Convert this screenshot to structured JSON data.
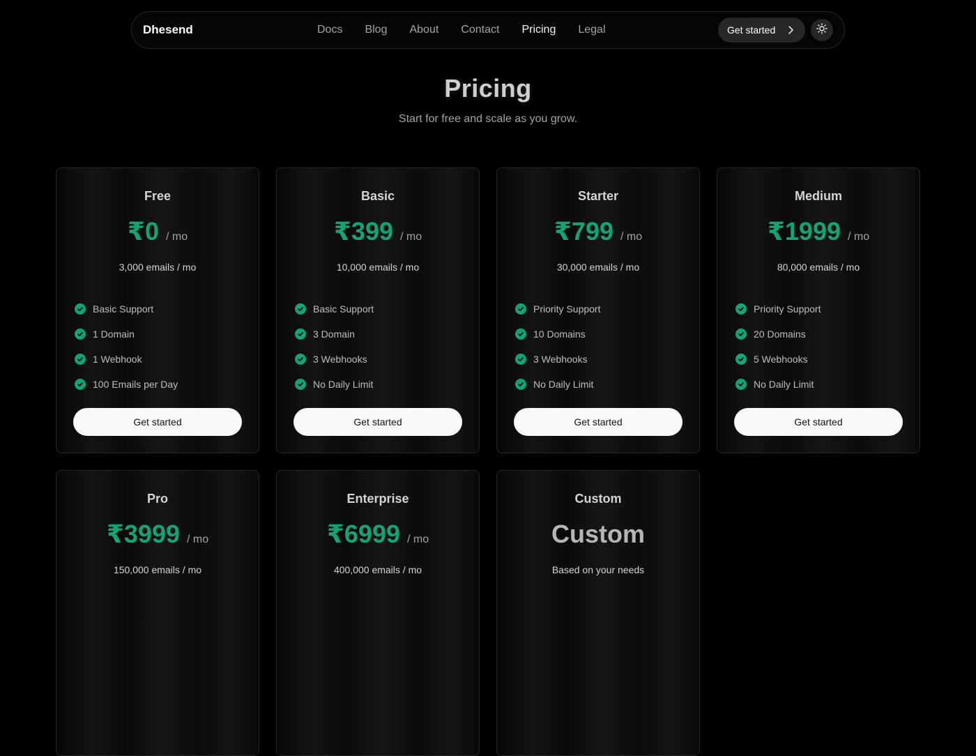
{
  "nav": {
    "brand": "Dhesend",
    "links": [
      "Docs",
      "Blog",
      "About",
      "Contact",
      "Pricing",
      "Legal"
    ],
    "active": "Pricing",
    "cta": "Get started"
  },
  "hero": {
    "title": "Pricing",
    "subtitle": "Start for free and scale as you grow."
  },
  "plans": [
    {
      "name": "Free",
      "price": "₹0",
      "period": "/ mo",
      "quota": "3,000 emails / mo",
      "features": [
        "Basic Support",
        "1 Domain",
        "1 Webhook",
        "100 Emails per Day"
      ],
      "cta": "Get started"
    },
    {
      "name": "Basic",
      "price": "₹399",
      "period": "/ mo",
      "quota": "10,000 emails / mo",
      "features": [
        "Basic Support",
        "3 Domain",
        "3 Webhooks",
        "No Daily Limit"
      ],
      "cta": "Get started"
    },
    {
      "name": "Starter",
      "price": "₹799",
      "period": "/ mo",
      "quota": "30,000 emails / mo",
      "features": [
        "Priority Support",
        "10 Domains",
        "3 Webhooks",
        "No Daily Limit"
      ],
      "cta": "Get started"
    },
    {
      "name": "Medium",
      "price": "₹1999",
      "period": "/ mo",
      "quota": "80,000 emails / mo",
      "features": [
        "Priority Support",
        "20 Domains",
        "5 Webhooks",
        "No Daily Limit"
      ],
      "cta": "Get started"
    },
    {
      "name": "Pro",
      "price": "₹3999",
      "period": "/ mo",
      "quota": "150,000 emails / mo",
      "features": [],
      "cta": ""
    },
    {
      "name": "Enterprise",
      "price": "₹6999",
      "period": "/ mo",
      "quota": "400,000 emails / mo",
      "features": [],
      "cta": ""
    },
    {
      "name": "Custom",
      "price": "Custom",
      "period": "",
      "quota": "Based on your needs",
      "features": [],
      "cta": ""
    }
  ],
  "colors": {
    "accent": "#16a374",
    "background": "#000000",
    "card_border": "#262626"
  }
}
